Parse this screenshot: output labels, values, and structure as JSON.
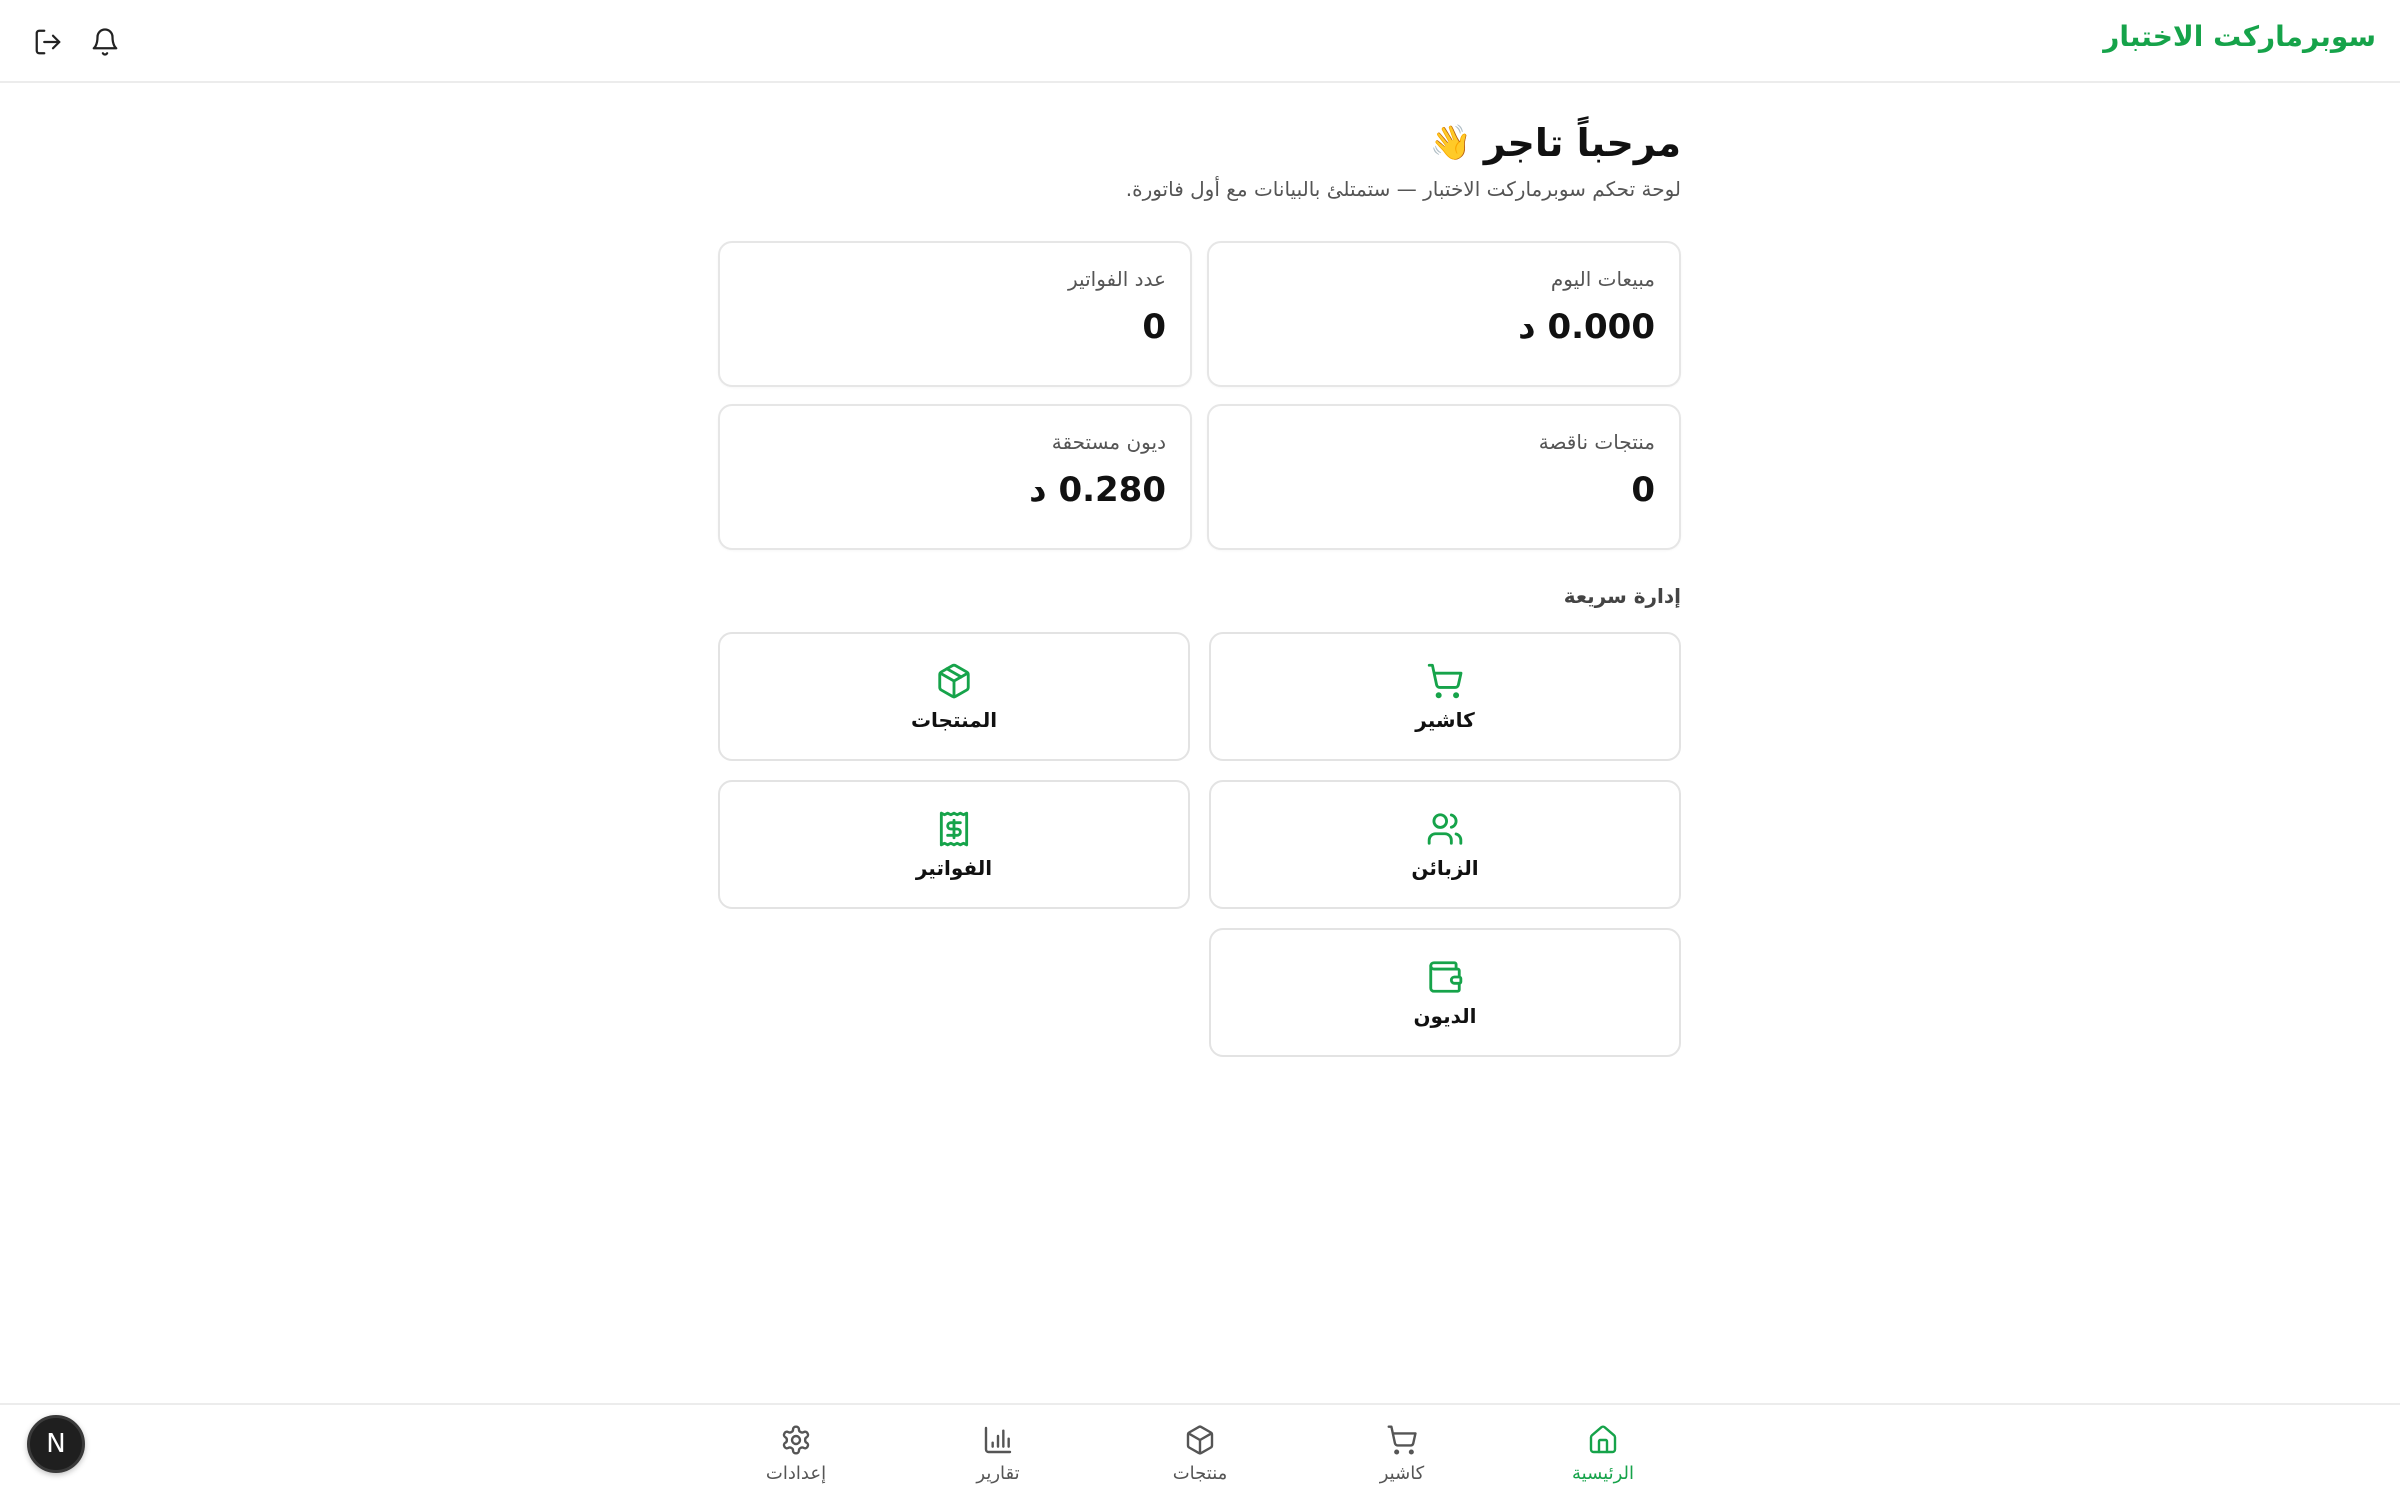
{
  "header": {
    "brand": "سوبرماركت الاختبار",
    "icons": [
      "logout-icon",
      "bell-icon"
    ]
  },
  "welcome": {
    "title": "مرحباً تاجر",
    "emoji": "👋",
    "subtitle": "لوحة تحكم سوبرماركت الاختبار — ستمتلئ بالبيانات مع أول فاتورة."
  },
  "stats": [
    {
      "label": "مبيعات اليوم",
      "value": "0.000 د"
    },
    {
      "label": "عدد الفواتير",
      "value": "0"
    },
    {
      "label": "منتجات ناقصة",
      "value": "0"
    },
    {
      "label": "ديون مستحقة",
      "value": "0.280 د"
    }
  ],
  "quick": {
    "title": "إدارة سريعة",
    "items": [
      {
        "label": "كاشير",
        "icon": "cart-icon"
      },
      {
        "label": "المنتجات",
        "icon": "box-icon"
      },
      {
        "label": "الزبائن",
        "icon": "users-icon"
      },
      {
        "label": "الفواتير",
        "icon": "receipt-icon"
      },
      {
        "label": "الديون",
        "icon": "wallet-icon"
      }
    ]
  },
  "nav": {
    "home": "الرئيسية",
    "cashier": "كاشير",
    "products": "منتجات",
    "reports": "تقارير",
    "settings": "إعدادات"
  },
  "fab": {
    "label": "N"
  },
  "colors": {
    "accent": "#16a34a",
    "text": "#111111",
    "muted": "#555555",
    "border": "#e6e6e6"
  }
}
